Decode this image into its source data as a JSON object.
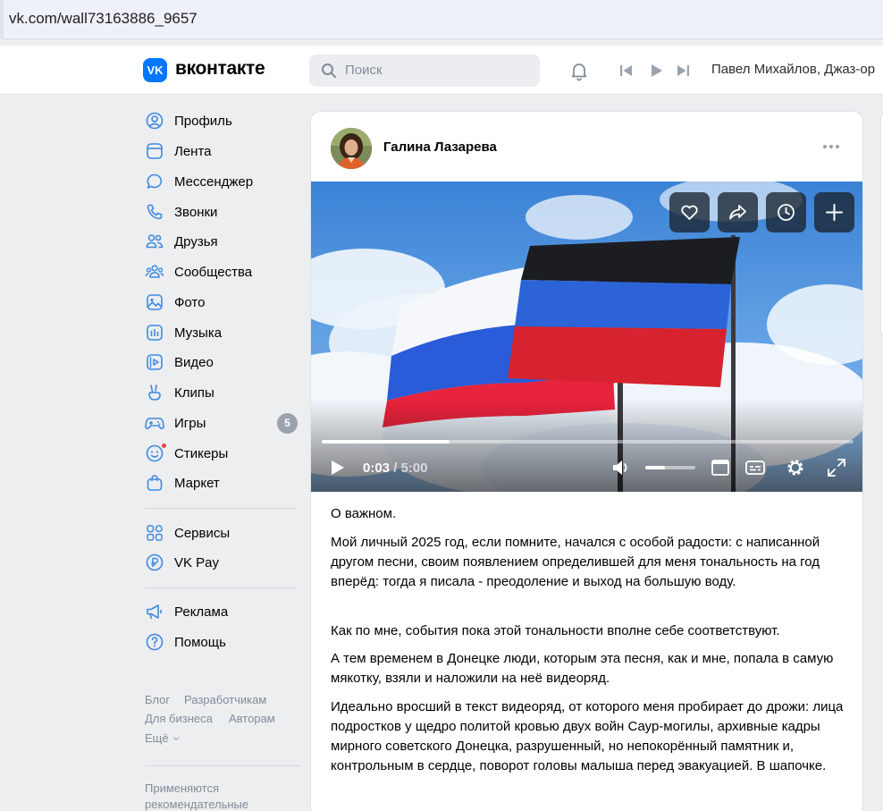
{
  "browser": {
    "url": "vk.com/wall73163886_9657"
  },
  "header": {
    "logo_mark": "VK",
    "logo_text": "вконтакте",
    "search_placeholder": "Поиск",
    "now_playing": "Павел Михайлов, Джаз-ор"
  },
  "sidebar": {
    "items": [
      {
        "label": "Профиль",
        "icon": "profile-icon"
      },
      {
        "label": "Лента",
        "icon": "feed-icon"
      },
      {
        "label": "Мессенджер",
        "icon": "messenger-icon"
      },
      {
        "label": "Звонки",
        "icon": "phone-icon"
      },
      {
        "label": "Друзья",
        "icon": "friends-icon"
      },
      {
        "label": "Сообщества",
        "icon": "communities-icon"
      },
      {
        "label": "Фото",
        "icon": "photo-icon"
      },
      {
        "label": "Музыка",
        "icon": "music-icon"
      },
      {
        "label": "Видео",
        "icon": "video-icon"
      },
      {
        "label": "Клипы",
        "icon": "clips-icon"
      },
      {
        "label": "Игры",
        "icon": "games-icon",
        "badge": "5"
      },
      {
        "label": "Стикеры",
        "icon": "stickers-icon"
      },
      {
        "label": "Маркет",
        "icon": "market-icon"
      }
    ],
    "secondary": [
      {
        "label": "Сервисы",
        "icon": "services-icon"
      },
      {
        "label": "VK Pay",
        "icon": "vkpay-icon"
      }
    ],
    "tertiary": [
      {
        "label": "Реклама",
        "icon": "ads-icon"
      },
      {
        "label": "Помощь",
        "icon": "help-icon"
      }
    ],
    "footer_links": [
      "Блог",
      "Разработчикам",
      "Для бизнеса",
      "Авторам",
      "Ещё"
    ],
    "footer_note_1": "Применяются",
    "footer_note_2": "рекомендательные"
  },
  "post": {
    "author": "Галина Лазарева",
    "video": {
      "current_time": "0:03",
      "separator": " / ",
      "duration": "5:00",
      "progress": 0.24,
      "volume": 0.4
    },
    "paragraphs": [
      "О важном.",
      "Мой личный 2025 год, если помните, начался с особой радости: с написанной другом песни, своим появлением определившей для меня тональность на год вперёд: тогда я писала - преодоление и выход на большую воду.",
      "Как по мне, события пока этой тональности вполне себе соответствуют.",
      "А тем временем в Донецке люди, которым эта песня, как и мне, попала в самую мякотку, взяли и наложили на неё видеоряд.",
      "Идеально вросший в текст видеоряд, от которого меня пробирает до дрожи: лица подростков у щедро политой кровью двух войн Саур-могилы, архивные кадры мирного советского Донецка, разрушенный, но непокорённый памятник и, контрольным в сердце, поворот головы малыша перед эвакуацией. В шапочке."
    ]
  },
  "colors": {
    "accent": "#0077ff",
    "page_bg": "#edeef0",
    "muted": "#818c99"
  }
}
